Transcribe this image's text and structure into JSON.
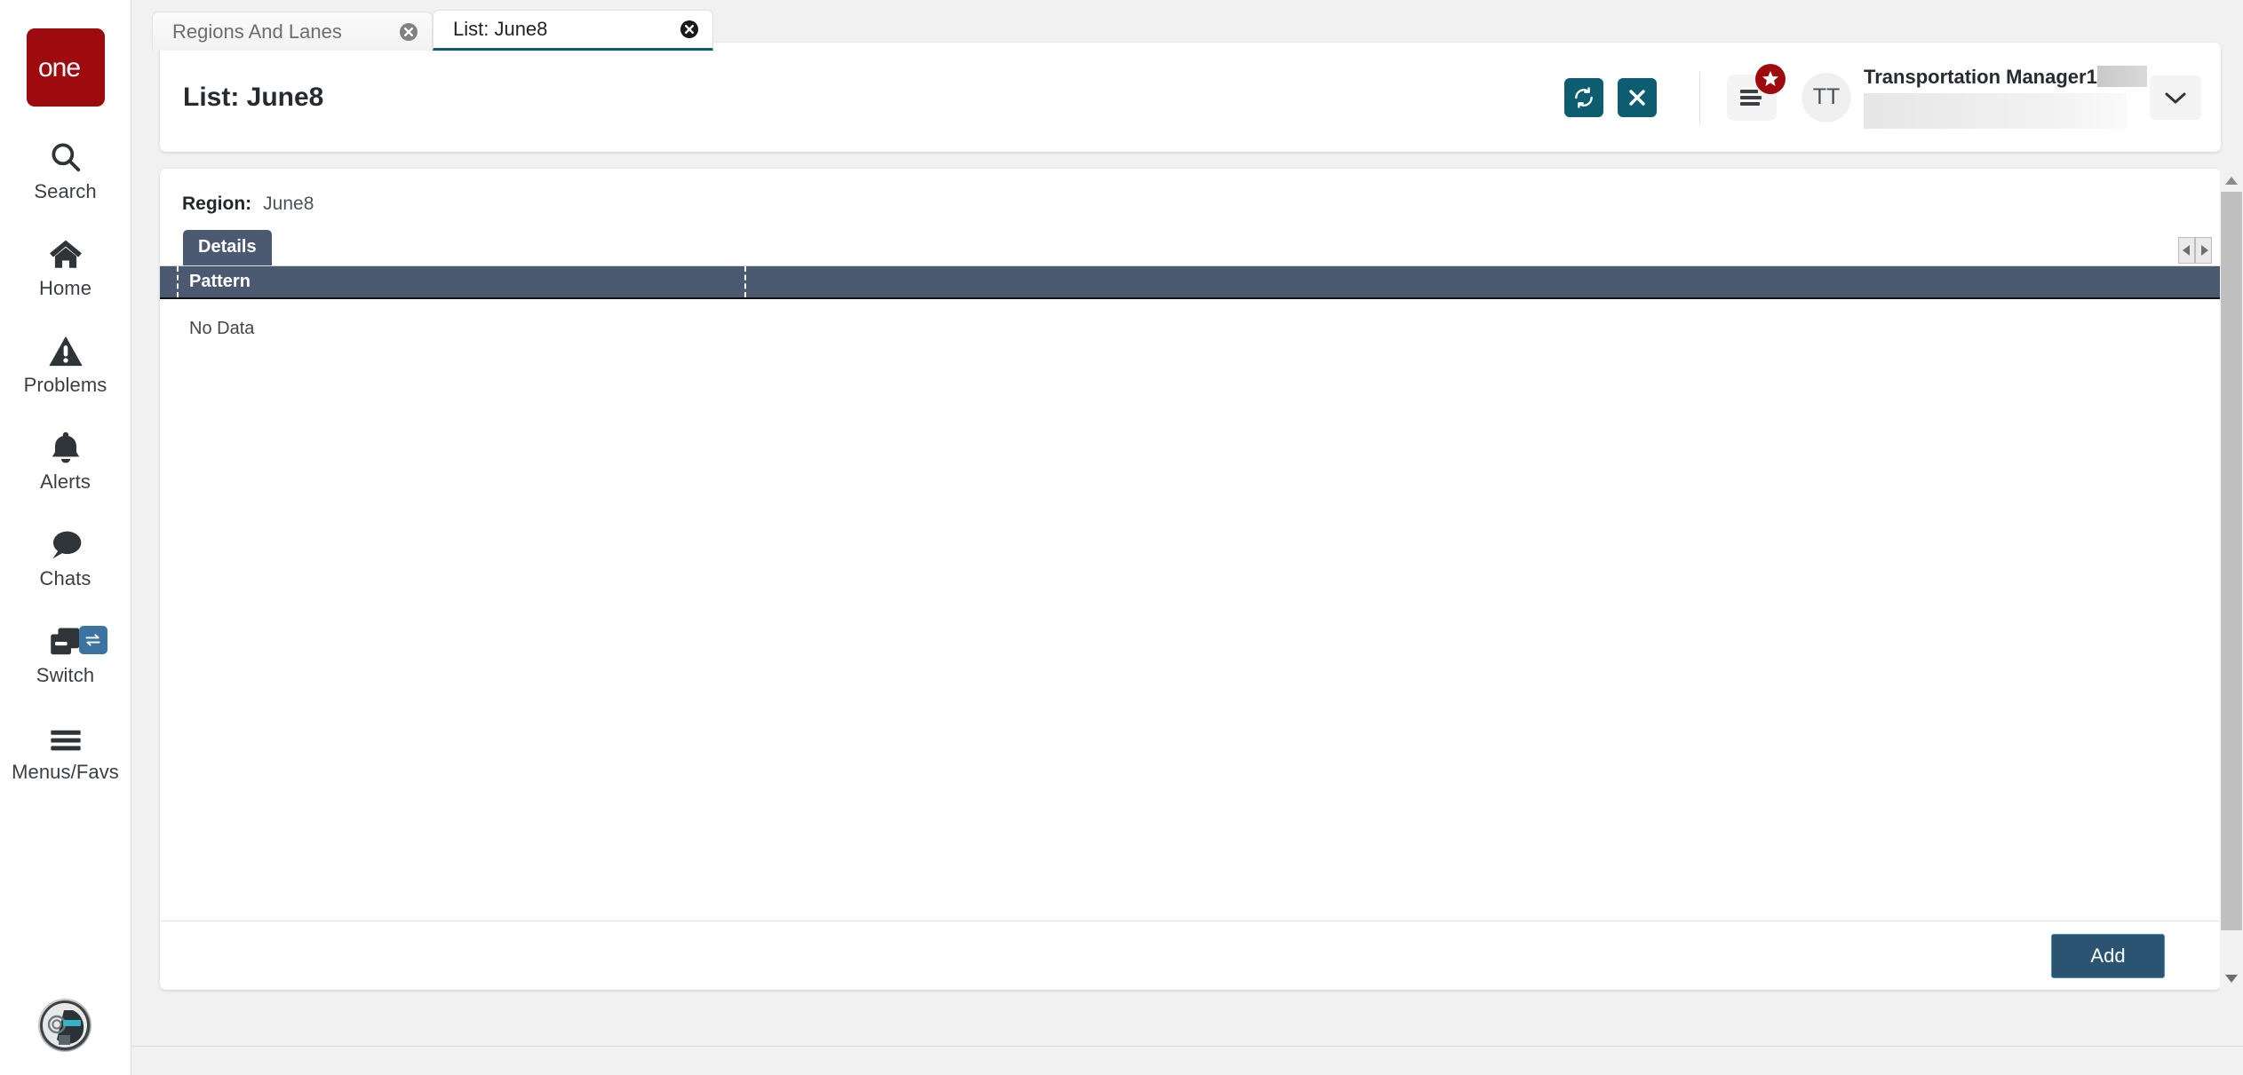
{
  "brand": {
    "logo_text": "one",
    "logo_color": "#9e0b0f"
  },
  "sidebar": {
    "items": [
      {
        "label": "Search",
        "icon": "search-icon"
      },
      {
        "label": "Home",
        "icon": "home-icon"
      },
      {
        "label": "Problems",
        "icon": "warning-triangle-icon"
      },
      {
        "label": "Alerts",
        "icon": "bell-icon"
      },
      {
        "label": "Switch",
        "icon": "copy-windows-icon",
        "badge_icon": "swap-arrows-icon"
      },
      {
        "label": "Menus/Favs",
        "icon": "hamburger-icon"
      }
    ],
    "avatar": "user-avatar-image"
  },
  "tabs": [
    {
      "label": "Regions And Lanes",
      "active": false,
      "close_icon": "close-circle-icon"
    },
    {
      "label": "List: June8",
      "active": true,
      "close_icon": "close-circle-icon"
    }
  ],
  "header": {
    "title": "List: June8",
    "actions": [
      {
        "name": "refresh-button",
        "icon": "refresh-icon",
        "color": "#0d5c70"
      },
      {
        "name": "close-button",
        "icon": "x-icon",
        "color": "#0d5c70"
      }
    ],
    "menu_button": {
      "icon": "list-lines-icon",
      "badge_icon": "star-icon",
      "badge_color": "#9e0b0f"
    },
    "user": {
      "initials": "TT",
      "name": "Transportation Manager1",
      "name_redacted_suffix": true,
      "secondary_redacted": true,
      "caret_icon": "chevron-down-icon"
    }
  },
  "content": {
    "region_label": "Region:",
    "region_value": "June8",
    "tabs": [
      {
        "label": "Details",
        "active": true
      }
    ],
    "tab_scroll": {
      "left_icon": "chevron-left-icon",
      "right_icon": "chevron-right-icon"
    },
    "grid": {
      "columns": [
        "Pattern",
        ""
      ],
      "rows": [],
      "empty_text": "No Data"
    },
    "footer": {
      "add_label": "Add"
    }
  },
  "scrollbar": {
    "up_icon": "caret-up-icon",
    "down_icon": "caret-down-icon"
  },
  "colors": {
    "brand_red": "#9e0b0f",
    "teal": "#0d5c70",
    "grid_header": "#4b5a70",
    "add_button": "#2a5471",
    "accent_blue": "#3d73a0"
  }
}
